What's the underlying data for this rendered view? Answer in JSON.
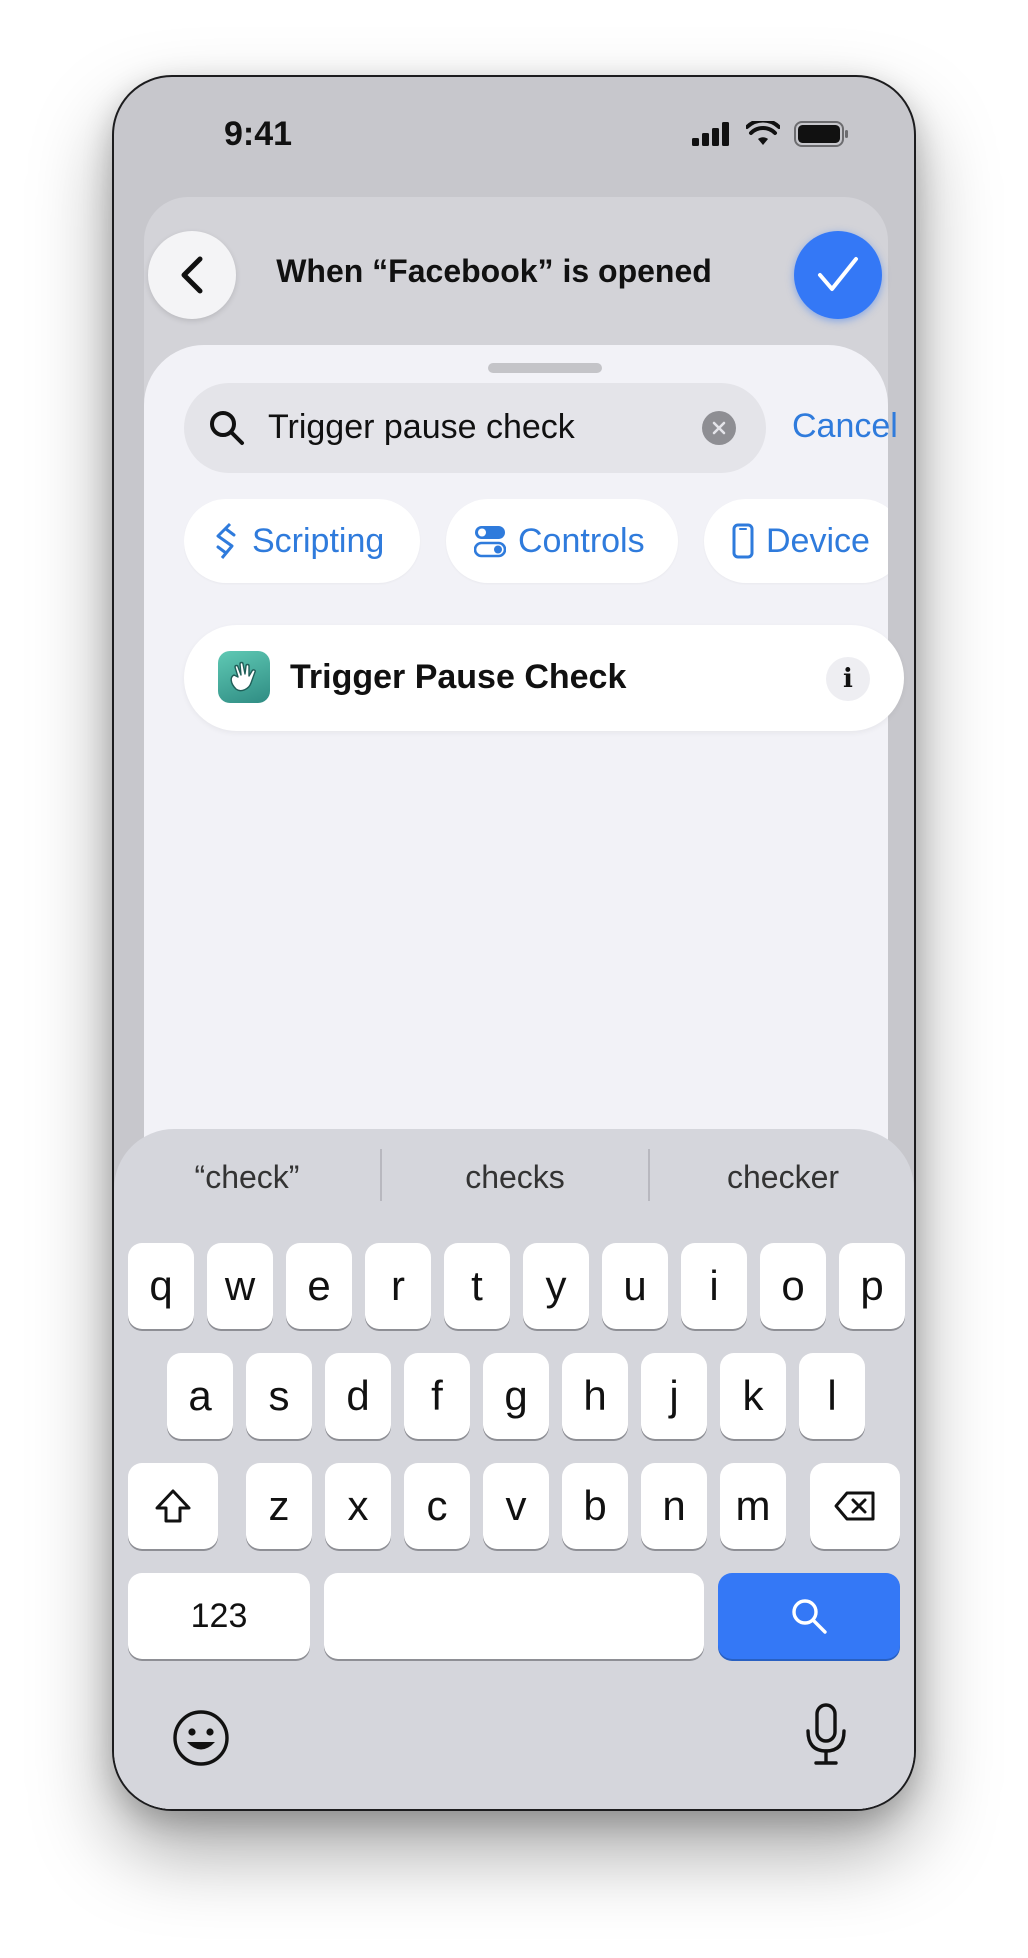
{
  "status_bar": {
    "time": "9:41"
  },
  "header": {
    "title": "When “Facebook” is opened"
  },
  "search": {
    "value": "Trigger pause check",
    "cancel_label": "Cancel"
  },
  "categories": [
    {
      "label": "Scripting",
      "icon": "scripting-icon"
    },
    {
      "label": "Controls",
      "icon": "controls-icon"
    },
    {
      "label": "Device",
      "icon": "device-icon"
    }
  ],
  "result": {
    "label": "Trigger Pause Check",
    "info": "i",
    "icon": "waving-hand-icon"
  },
  "keyboard": {
    "suggestions": [
      "“check”",
      "checks",
      "checker"
    ],
    "row1": [
      "q",
      "w",
      "e",
      "r",
      "t",
      "y",
      "u",
      "i",
      "o",
      "p"
    ],
    "row2": [
      "a",
      "s",
      "d",
      "f",
      "g",
      "h",
      "j",
      "k",
      "l"
    ],
    "row3": [
      "z",
      "x",
      "c",
      "v",
      "b",
      "n",
      "m"
    ],
    "numbers_label": "123"
  },
  "colors": {
    "accent": "#3478f6",
    "link": "#2f7bdc"
  }
}
